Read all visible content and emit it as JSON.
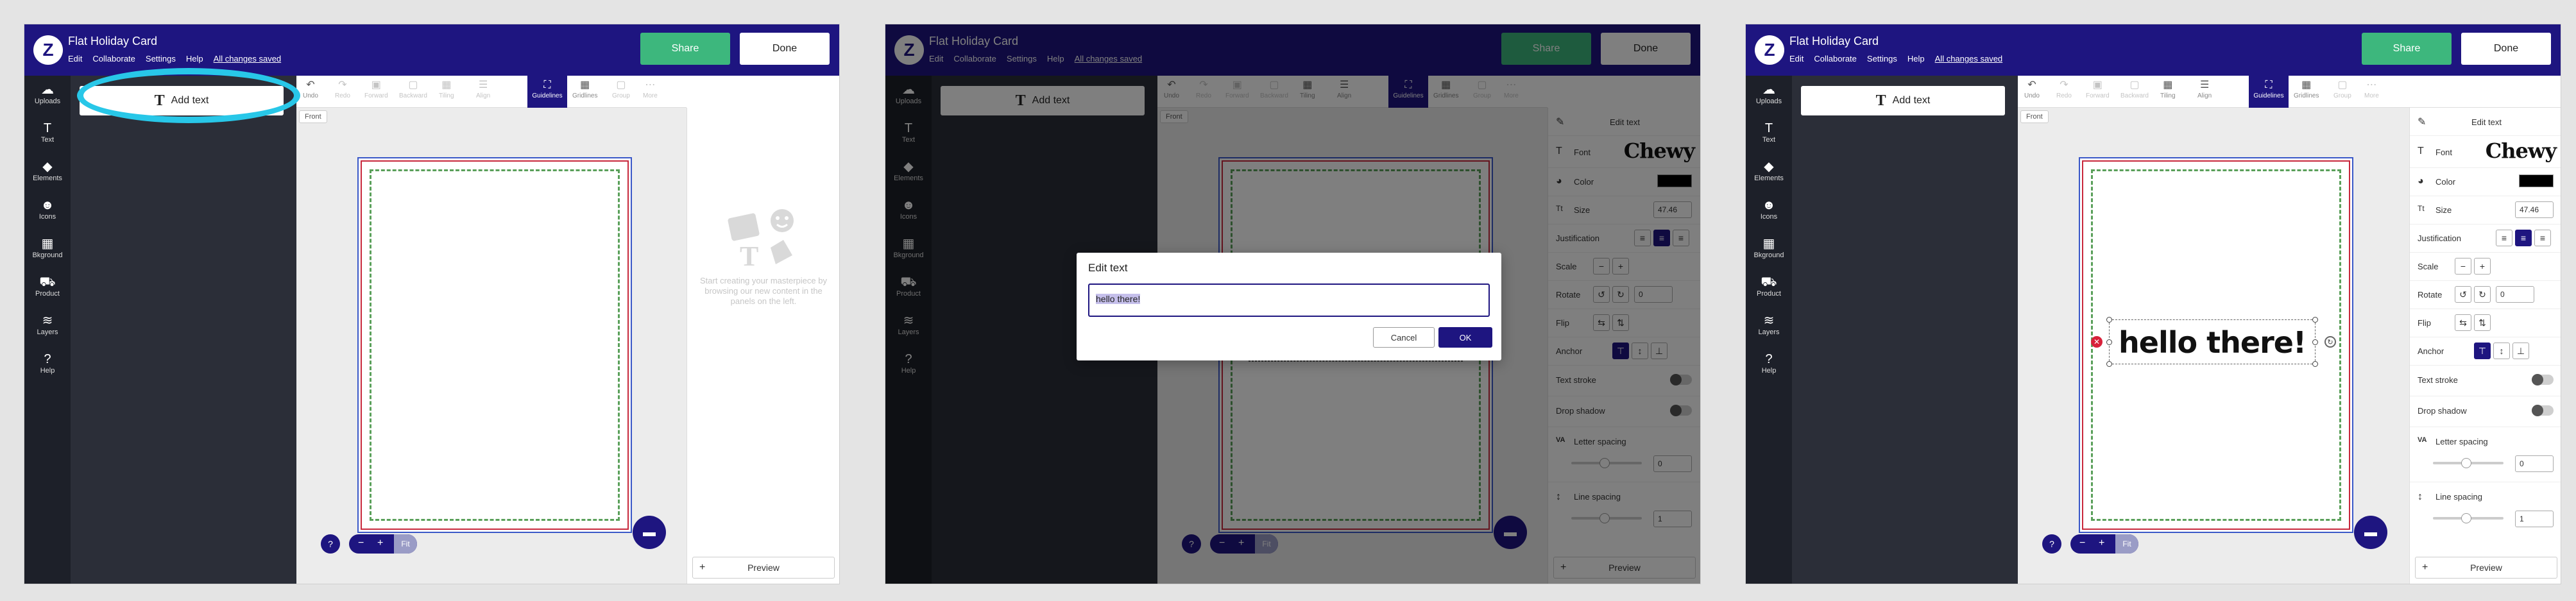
{
  "app": {
    "title": "Flat Holiday Card",
    "menu": [
      "Edit",
      "Collaborate",
      "Settings",
      "Help"
    ],
    "saved_status": "All changes saved",
    "share_label": "Share",
    "done_label": "Done",
    "logo_glyph": "Z"
  },
  "rail": [
    {
      "label": "Uploads",
      "icon": "cloud-upload-icon",
      "glyph": "☁"
    },
    {
      "label": "Text",
      "icon": "text-icon",
      "glyph": "T"
    },
    {
      "label": "Elements",
      "icon": "elements-icon",
      "glyph": "◆"
    },
    {
      "label": "Icons",
      "icon": "smiley-icon",
      "glyph": "☻"
    },
    {
      "label": "Bkground",
      "icon": "background-icon",
      "glyph": "▦"
    },
    {
      "label": "Product",
      "icon": "product-icon",
      "glyph": "⛟"
    },
    {
      "label": "Layers",
      "icon": "layers-icon",
      "glyph": "≋"
    },
    {
      "label": "Help",
      "icon": "help-icon",
      "glyph": "?"
    }
  ],
  "drawer": {
    "add_text_label": "Add text",
    "add_text_glyph": "T",
    "collapse_glyph": "‹"
  },
  "toolbar": {
    "undo": "Undo",
    "redo": "Redo",
    "forward": "Forward",
    "backward": "Backward",
    "tiling": "Tiling",
    "align": "Align",
    "guidelines": "Guidelines",
    "gridlines": "Gridlines",
    "group": "Group",
    "more": "More",
    "glyphs": {
      "undo": "↶",
      "redo": "↷",
      "forward": "▣",
      "backward": "▢",
      "tiling": "▦",
      "align": "☰",
      "guidelines": "⛶",
      "gridlines": "▦",
      "group": "▢",
      "more": "⋯"
    }
  },
  "canvas": {
    "front_label": "Front"
  },
  "zoom": {
    "help": "?",
    "minus": "−",
    "plus": "+",
    "fit": "Fit"
  },
  "chat_glyph": "▬",
  "empty_panel": {
    "message": "Start creating your masterpiece by browsing our new content in the panels on the left."
  },
  "preview": {
    "label": "Preview",
    "plus": "+"
  },
  "dialog": {
    "title": "Edit text",
    "value": "hello there!",
    "cancel": "Cancel",
    "ok": "OK"
  },
  "text_props": {
    "header": "Edit text",
    "font_label": "Font",
    "font_value": "Chewy",
    "color_label": "Color",
    "color_value": "#000000",
    "size_label": "Size",
    "size_value": "47.46",
    "justification_label": "Justification",
    "scale_label": "Scale",
    "scale_minus": "−",
    "scale_plus": "+",
    "rotate_label": "Rotate",
    "rotate_value": "0",
    "flip_label": "Flip",
    "anchor_label": "Anchor",
    "stroke_label": "Text stroke",
    "shadow_label": "Drop shadow",
    "letter_spacing_label": "Letter spacing",
    "letter_spacing_value": "0",
    "line_spacing_label": "Line spacing",
    "line_spacing_value": "1",
    "glyphs": {
      "edit": "✎",
      "font": "T",
      "color": "◕",
      "size": "Tt",
      "letter": "VA",
      "line": "↕",
      "left": "≡",
      "center": "≡",
      "right": "≡",
      "rotl": "↺",
      "rotr": "↻",
      "fliph": "⇆",
      "flipv": "⇅",
      "a_top": "⊤",
      "a_mid": "↕",
      "a_bot": "⊥"
    }
  },
  "canvas_text": {
    "content": "hello there!"
  },
  "colors": {
    "brand": "#1e1580",
    "share": "#3db77d",
    "highlight_ring": "#28c7e8",
    "card_border": "#c8283c",
    "card_outer": "#3a58c8",
    "guide": "#5aa05a",
    "delete": "#d8213a"
  }
}
